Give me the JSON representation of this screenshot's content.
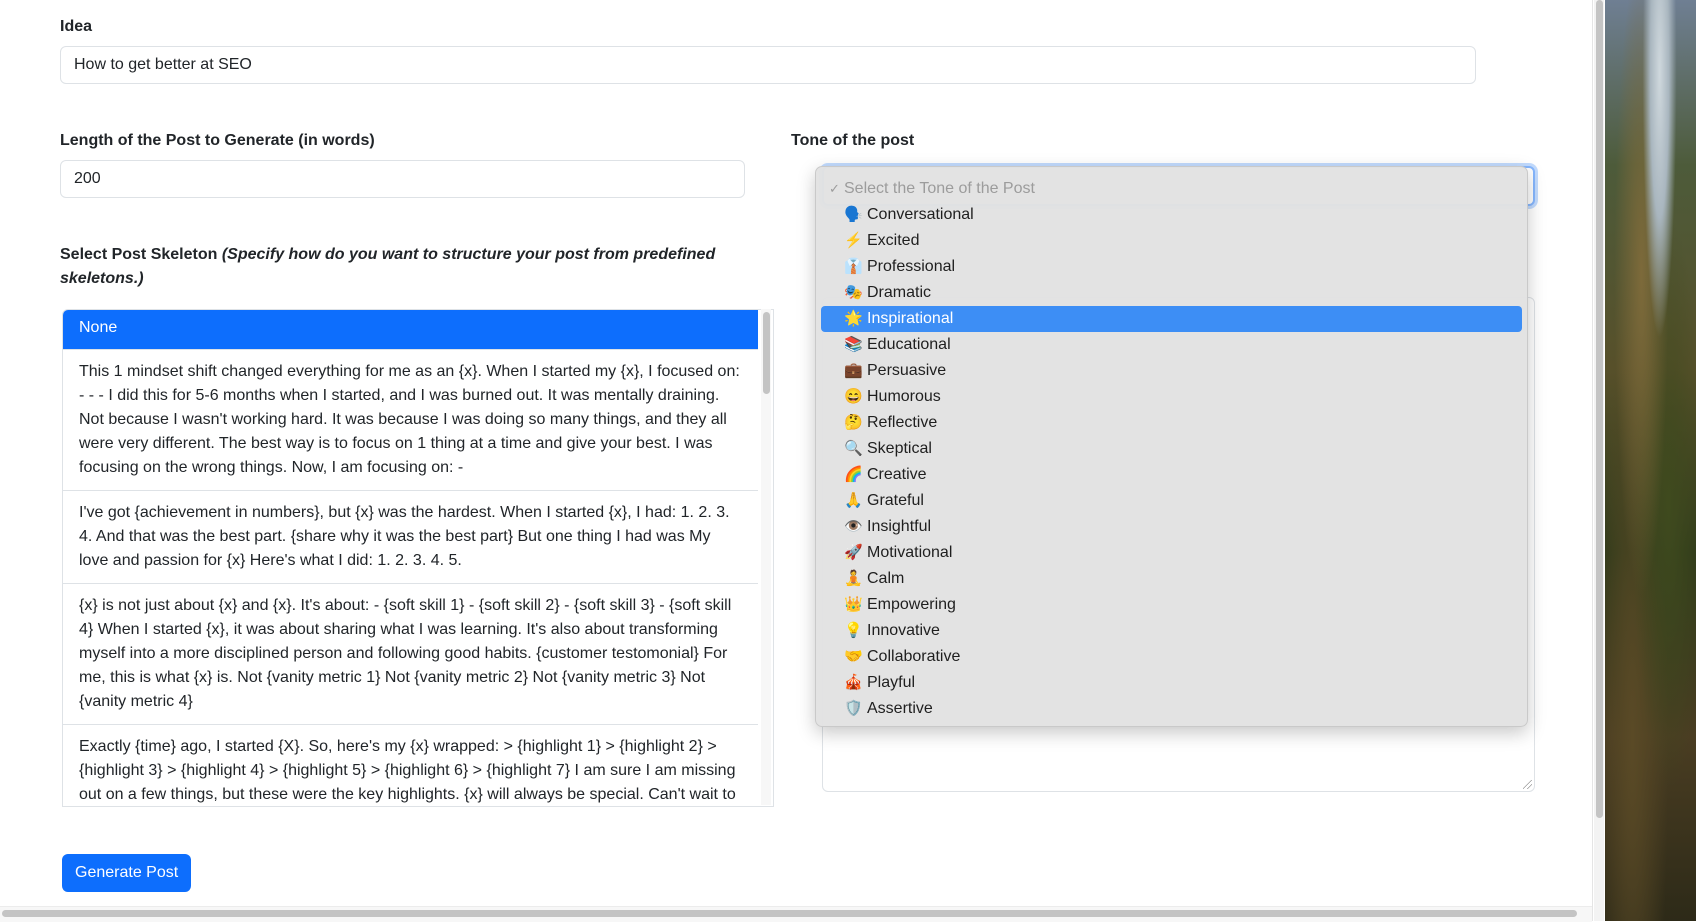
{
  "idea": {
    "label": "Idea",
    "value": "How to get better at SEO"
  },
  "length": {
    "label": "Length of the Post to Generate (in words)",
    "value": "200"
  },
  "tone": {
    "label": "Tone of the post",
    "placeholder": "Select the Tone of the Post",
    "selected": "Inspirational",
    "options": [
      {
        "emoji": "🗣️",
        "label": "Conversational"
      },
      {
        "emoji": "⚡",
        "label": "Excited"
      },
      {
        "emoji": "👔",
        "label": "Professional"
      },
      {
        "emoji": "🎭",
        "label": "Dramatic"
      },
      {
        "emoji": "🌟",
        "label": "Inspirational"
      },
      {
        "emoji": "📚",
        "label": "Educational"
      },
      {
        "emoji": "💼",
        "label": "Persuasive"
      },
      {
        "emoji": "😄",
        "label": "Humorous"
      },
      {
        "emoji": "🤔",
        "label": "Reflective"
      },
      {
        "emoji": "🔍",
        "label": "Skeptical"
      },
      {
        "emoji": "🌈",
        "label": "Creative"
      },
      {
        "emoji": "🙏",
        "label": "Grateful"
      },
      {
        "emoji": "👁️",
        "label": "Insightful"
      },
      {
        "emoji": "🚀",
        "label": "Motivational"
      },
      {
        "emoji": "🧘",
        "label": "Calm"
      },
      {
        "emoji": "👑",
        "label": "Empowering"
      },
      {
        "emoji": "💡",
        "label": "Innovative"
      },
      {
        "emoji": "🤝",
        "label": "Collaborative"
      },
      {
        "emoji": "🎪",
        "label": "Playful"
      },
      {
        "emoji": "🛡️",
        "label": "Assertive"
      }
    ]
  },
  "skeleton": {
    "label_bold": "Select Post Skeleton",
    "label_italic": "(Specify how do you want to structure your post from predefined skeletons.)",
    "items": [
      "None",
      "This 1 mindset shift changed everything for me as an {x}. When I started my {x}, I focused on: - - - I did this for 5-6 months when I started, and I was burned out. It was mentally draining. Not because I wasn't working hard. It was because I was doing so many things, and they all were very different. The best way is to focus on 1 thing at a time and give your best. I was focusing on the wrong things. Now, I am focusing on: -",
      "I've got {achievement in numbers}, but {x} was the hardest. When I started {x}, I had: 1. 2. 3. 4. And that was the best part. {share why it was the best part} But one thing I had was My love and passion for {x} Here's what I did: 1. 2. 3. 4. 5.",
      "{x} is not just about {x} and {x}. It's about: - {soft skill 1} - {soft skill 2} - {soft skill 3} - {soft skill 4} When I started {x}, it was about sharing what I was learning. It's also about transforming myself into a more disciplined person and following good habits. {customer testomonial} For me, this is what {x} is. Not {vanity metric 1} Not {vanity metric 2} Not {vanity metric 3} Not {vanity metric 4}",
      "Exactly {time} ago, I started {X}. So, here's my {x} wrapped: > {highlight 1} > {highlight 2} > {highlight 3} > {highlight 4} > {highlight 5} > {highlight 6} > {highlight 7} I am sure I am missing out on a few things, but these were the key highlights. {x} will always be special. Can't wait to see what {X} has in store."
    ]
  },
  "generate_button": "Generate Post"
}
